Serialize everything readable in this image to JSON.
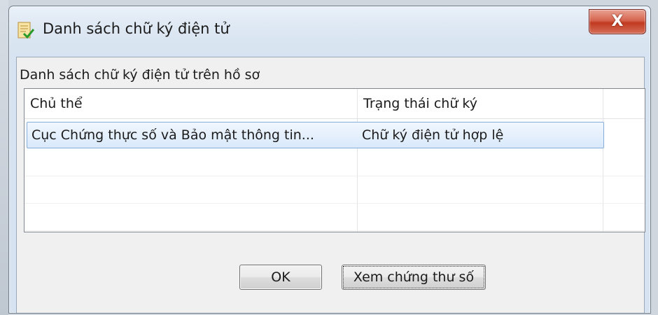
{
  "window": {
    "title": "Danh sách chữ ký điện tử",
    "close_label": "X"
  },
  "main": {
    "section_label": "Danh sách chữ ký điện tử trên hồ sơ",
    "table": {
      "columns": [
        "Chủ thể",
        "Trạng thái chữ ký"
      ],
      "rows": [
        [
          "Cục Chứng thực số và Bảo mật thông tin...",
          "Chữ ký điện tử hợp lệ"
        ]
      ]
    }
  },
  "buttons": {
    "ok_label": "OK",
    "view_cert_label": "Xem chứng thư số"
  },
  "colors": {
    "selection": "#d9e9fb",
    "selection_border": "#84acdd",
    "close_button": "#c0391f"
  }
}
